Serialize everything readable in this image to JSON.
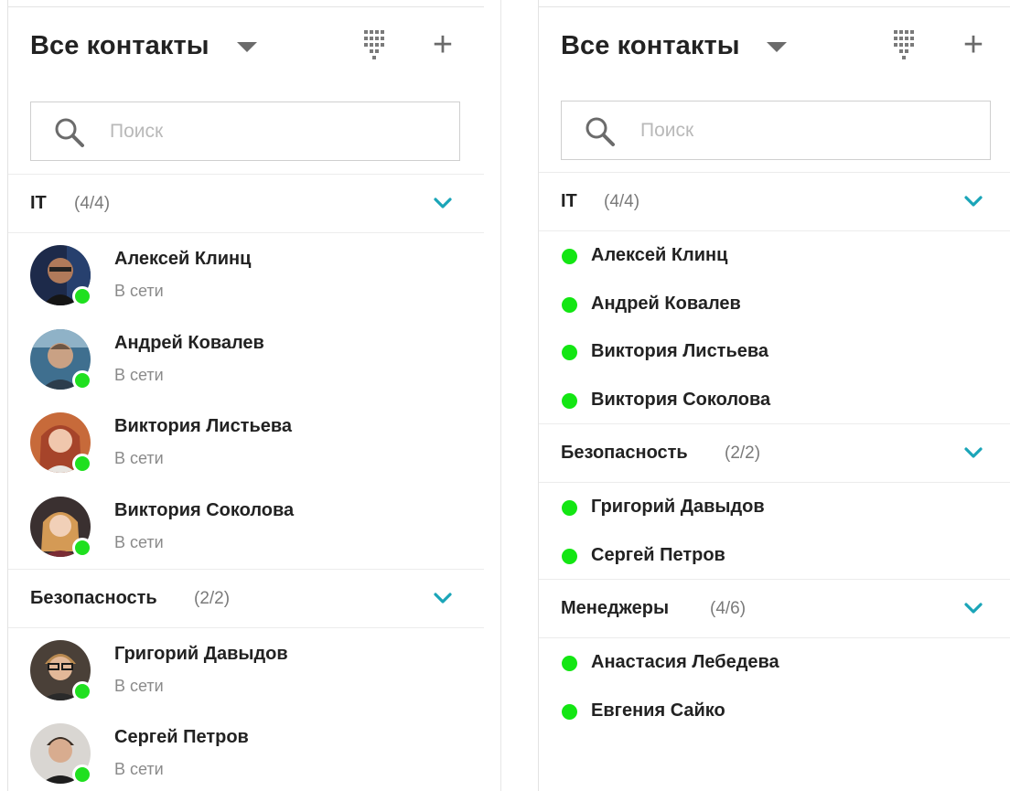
{
  "accent_color": "#1aa5b8",
  "online_color": "#1fe01f",
  "left": {
    "header": {
      "title": "Все контакты",
      "caret_icon": "triangle-down-icon",
      "dialpad_icon": "dialpad-icon",
      "add_icon": "+"
    },
    "search": {
      "placeholder": "Поиск",
      "icon": "search-icon"
    },
    "groups": [
      {
        "name": "IT",
        "count": "(4/4)",
        "contacts": [
          {
            "name": "Алексей Клинц",
            "status": "В сети"
          },
          {
            "name": "Андрей Ковалев",
            "status": "В сети"
          },
          {
            "name": "Виктория Листьева",
            "status": "В сети"
          },
          {
            "name": "Виктория Соколова",
            "status": "В сети"
          }
        ]
      },
      {
        "name": "Безопасность",
        "count": "(2/2)",
        "contacts": [
          {
            "name": "Григорий Давыдов",
            "status": "В сети"
          },
          {
            "name": "Сергей Петров",
            "status": "В сети"
          }
        ]
      }
    ]
  },
  "right": {
    "header": {
      "title": "Все контакты",
      "caret_icon": "triangle-down-icon",
      "dialpad_icon": "dialpad-icon",
      "add_icon": "+"
    },
    "search": {
      "placeholder": "Поиск",
      "icon": "search-icon"
    },
    "groups": [
      {
        "name": "IT",
        "count": "(4/4)",
        "contacts": [
          {
            "name": "Алексей Клинц"
          },
          {
            "name": "Андрей Ковалев"
          },
          {
            "name": "Виктория Листьева"
          },
          {
            "name": "Виктория Соколова"
          }
        ]
      },
      {
        "name": "Безопасность",
        "count": "(2/2)",
        "contacts": [
          {
            "name": "Григорий Давыдов"
          },
          {
            "name": "Сергей Петров"
          }
        ]
      },
      {
        "name": "Менеджеры",
        "count": "(4/6)",
        "contacts": [
          {
            "name": "Анастасия Лебедева"
          },
          {
            "name": "Евгения Сайко"
          }
        ]
      }
    ]
  }
}
